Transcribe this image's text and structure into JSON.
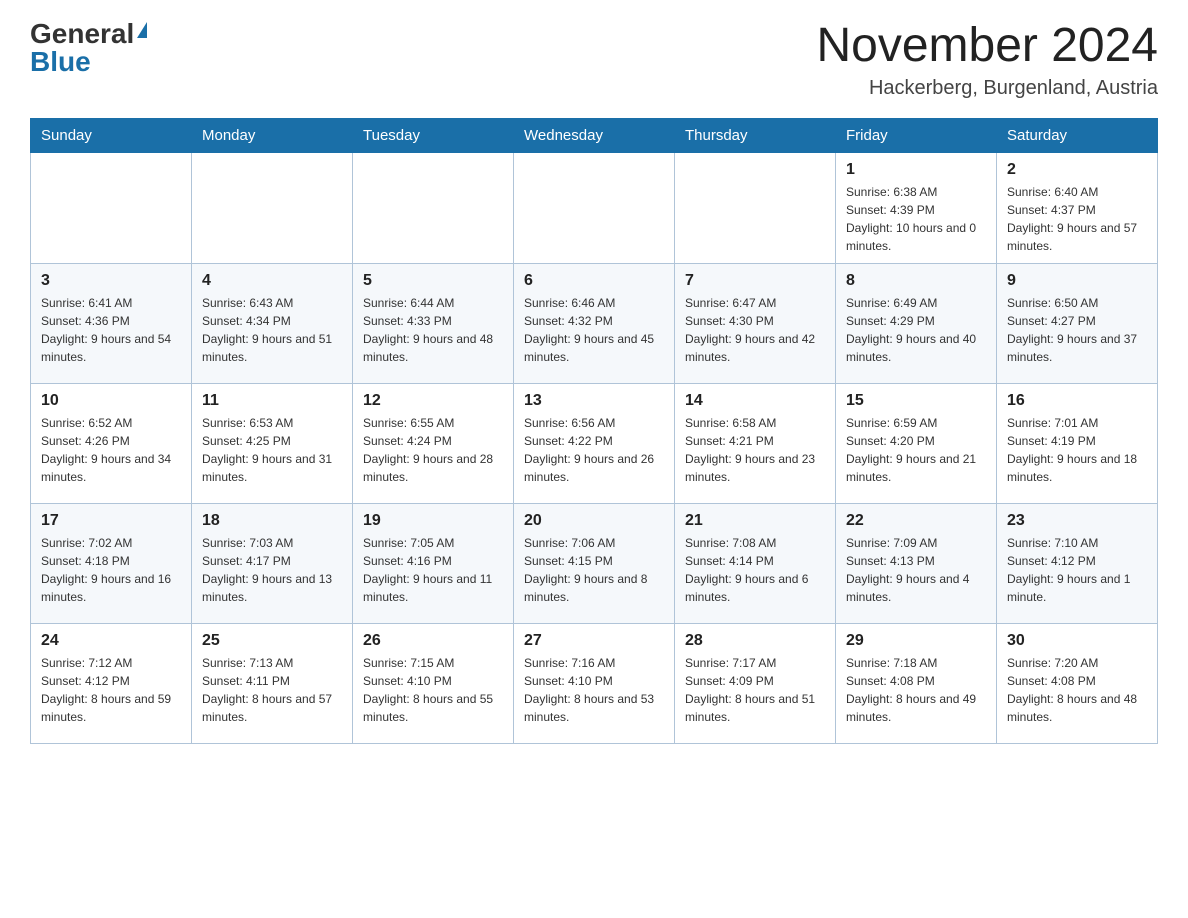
{
  "header": {
    "logo_general": "General",
    "logo_blue": "Blue",
    "title": "November 2024",
    "subtitle": "Hackerberg, Burgenland, Austria"
  },
  "weekdays": [
    "Sunday",
    "Monday",
    "Tuesday",
    "Wednesday",
    "Thursday",
    "Friday",
    "Saturday"
  ],
  "weeks": [
    [
      {
        "day": "",
        "info": ""
      },
      {
        "day": "",
        "info": ""
      },
      {
        "day": "",
        "info": ""
      },
      {
        "day": "",
        "info": ""
      },
      {
        "day": "",
        "info": ""
      },
      {
        "day": "1",
        "info": "Sunrise: 6:38 AM\nSunset: 4:39 PM\nDaylight: 10 hours and 0 minutes."
      },
      {
        "day": "2",
        "info": "Sunrise: 6:40 AM\nSunset: 4:37 PM\nDaylight: 9 hours and 57 minutes."
      }
    ],
    [
      {
        "day": "3",
        "info": "Sunrise: 6:41 AM\nSunset: 4:36 PM\nDaylight: 9 hours and 54 minutes."
      },
      {
        "day": "4",
        "info": "Sunrise: 6:43 AM\nSunset: 4:34 PM\nDaylight: 9 hours and 51 minutes."
      },
      {
        "day": "5",
        "info": "Sunrise: 6:44 AM\nSunset: 4:33 PM\nDaylight: 9 hours and 48 minutes."
      },
      {
        "day": "6",
        "info": "Sunrise: 6:46 AM\nSunset: 4:32 PM\nDaylight: 9 hours and 45 minutes."
      },
      {
        "day": "7",
        "info": "Sunrise: 6:47 AM\nSunset: 4:30 PM\nDaylight: 9 hours and 42 minutes."
      },
      {
        "day": "8",
        "info": "Sunrise: 6:49 AM\nSunset: 4:29 PM\nDaylight: 9 hours and 40 minutes."
      },
      {
        "day": "9",
        "info": "Sunrise: 6:50 AM\nSunset: 4:27 PM\nDaylight: 9 hours and 37 minutes."
      }
    ],
    [
      {
        "day": "10",
        "info": "Sunrise: 6:52 AM\nSunset: 4:26 PM\nDaylight: 9 hours and 34 minutes."
      },
      {
        "day": "11",
        "info": "Sunrise: 6:53 AM\nSunset: 4:25 PM\nDaylight: 9 hours and 31 minutes."
      },
      {
        "day": "12",
        "info": "Sunrise: 6:55 AM\nSunset: 4:24 PM\nDaylight: 9 hours and 28 minutes."
      },
      {
        "day": "13",
        "info": "Sunrise: 6:56 AM\nSunset: 4:22 PM\nDaylight: 9 hours and 26 minutes."
      },
      {
        "day": "14",
        "info": "Sunrise: 6:58 AM\nSunset: 4:21 PM\nDaylight: 9 hours and 23 minutes."
      },
      {
        "day": "15",
        "info": "Sunrise: 6:59 AM\nSunset: 4:20 PM\nDaylight: 9 hours and 21 minutes."
      },
      {
        "day": "16",
        "info": "Sunrise: 7:01 AM\nSunset: 4:19 PM\nDaylight: 9 hours and 18 minutes."
      }
    ],
    [
      {
        "day": "17",
        "info": "Sunrise: 7:02 AM\nSunset: 4:18 PM\nDaylight: 9 hours and 16 minutes."
      },
      {
        "day": "18",
        "info": "Sunrise: 7:03 AM\nSunset: 4:17 PM\nDaylight: 9 hours and 13 minutes."
      },
      {
        "day": "19",
        "info": "Sunrise: 7:05 AM\nSunset: 4:16 PM\nDaylight: 9 hours and 11 minutes."
      },
      {
        "day": "20",
        "info": "Sunrise: 7:06 AM\nSunset: 4:15 PM\nDaylight: 9 hours and 8 minutes."
      },
      {
        "day": "21",
        "info": "Sunrise: 7:08 AM\nSunset: 4:14 PM\nDaylight: 9 hours and 6 minutes."
      },
      {
        "day": "22",
        "info": "Sunrise: 7:09 AM\nSunset: 4:13 PM\nDaylight: 9 hours and 4 minutes."
      },
      {
        "day": "23",
        "info": "Sunrise: 7:10 AM\nSunset: 4:12 PM\nDaylight: 9 hours and 1 minute."
      }
    ],
    [
      {
        "day": "24",
        "info": "Sunrise: 7:12 AM\nSunset: 4:12 PM\nDaylight: 8 hours and 59 minutes."
      },
      {
        "day": "25",
        "info": "Sunrise: 7:13 AM\nSunset: 4:11 PM\nDaylight: 8 hours and 57 minutes."
      },
      {
        "day": "26",
        "info": "Sunrise: 7:15 AM\nSunset: 4:10 PM\nDaylight: 8 hours and 55 minutes."
      },
      {
        "day": "27",
        "info": "Sunrise: 7:16 AM\nSunset: 4:10 PM\nDaylight: 8 hours and 53 minutes."
      },
      {
        "day": "28",
        "info": "Sunrise: 7:17 AM\nSunset: 4:09 PM\nDaylight: 8 hours and 51 minutes."
      },
      {
        "day": "29",
        "info": "Sunrise: 7:18 AM\nSunset: 4:08 PM\nDaylight: 8 hours and 49 minutes."
      },
      {
        "day": "30",
        "info": "Sunrise: 7:20 AM\nSunset: 4:08 PM\nDaylight: 8 hours and 48 minutes."
      }
    ]
  ]
}
